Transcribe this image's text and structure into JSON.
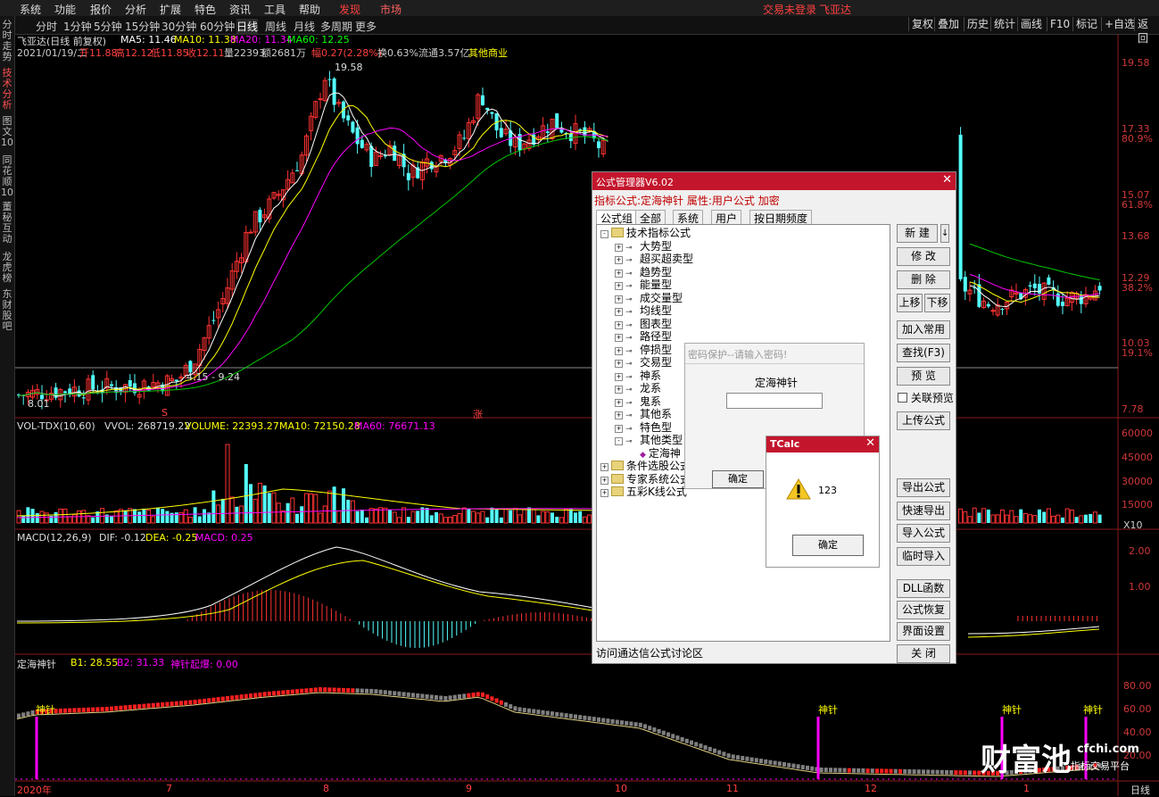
{
  "menu": {
    "items": [
      "系统",
      "功能",
      "报价",
      "分析",
      "扩展",
      "特色",
      "资讯",
      "工具",
      "帮助"
    ],
    "discover": "发现",
    "market": "市场",
    "login_status": "交易未登录",
    "stock_name": "飞亚达"
  },
  "toolbar": {
    "periods": [
      "分时",
      "1分钟",
      "5分钟",
      "15分钟",
      "30分钟",
      "60分钟",
      "日线",
      "周线",
      "月线",
      "多周期",
      "更多"
    ],
    "selected_period": "日线",
    "right_buttons": [
      "复权",
      "叠加",
      "历史",
      "统计",
      "画线",
      "F10",
      "标记",
      "+自选",
      "返回"
    ]
  },
  "left_tabs": [
    {
      "label": "分时走势",
      "active": false
    },
    {
      "label": "技术分析",
      "active": true
    },
    {
      "label": "图文10",
      "active": false
    },
    {
      "label": "同花顺10",
      "active": false
    },
    {
      "label": "董秘互动",
      "active": false
    },
    {
      "label": "龙虎榜",
      "active": false
    },
    {
      "label": "东财股吧",
      "active": false
    }
  ],
  "main_chart": {
    "title": "飞亚达(日线 前复权)",
    "ma": [
      {
        "label": "MA5: 11.46",
        "color": "#ffffff"
      },
      {
        "label": "MA10: 11.38",
        "color": "#ffff00"
      },
      {
        "label": "MA20: 11.34",
        "color": "#ff00ff"
      },
      {
        "label": "MA60: 12.25",
        "color": "#00ff00"
      }
    ],
    "quote_date": "2021/01/19/二",
    "quote_open": "开11.88",
    "quote_high": "高12.12",
    "quote_low": "低11.85",
    "quote_close": "收12.11",
    "quote_vol": "量22393",
    "quote_amt": "额2681万",
    "quote_chg": "幅0.27(2.28%)",
    "quote_turn": "换0.63%",
    "quote_float": "流通3.57亿",
    "quote_sector": "其他商业",
    "high_label": "19.58",
    "low_label": "8.01",
    "range_label": "4.15 - 9.24",
    "marker_s": "S",
    "marker_zhang": "涨",
    "axis": [
      "19.58",
      "17.33",
      "80.9%",
      "15.07",
      "61.8%",
      "13.68",
      "12.29",
      "38.2%",
      "10.03",
      "19.1%",
      "7.78"
    ]
  },
  "vol_chart": {
    "title": "VOL-TDX(10,60)",
    "vvol": "VVOL: 268719.22",
    "volume": "VOLUME: 22393.27",
    "ma10": "MA10: 72150.28",
    "ma60": "MA60: 76671.13",
    "axis": [
      "60000",
      "45000",
      "30000",
      "15000",
      "X10"
    ]
  },
  "macd_chart": {
    "title": "MACD(12,26,9)",
    "dif": "DIF: -0.12",
    "dea": "DEA: -0.25",
    "macd": "MACD: 0.25",
    "axis": [
      "2.00",
      "1.00"
    ]
  },
  "dh_chart": {
    "title": "定海神针",
    "b1": "B1: 28.55",
    "b2": "B2: 31.33",
    "qibao": "神针起爆: 0.00",
    "signal": "神针",
    "axis": [
      "80.00",
      "60.00",
      "40.00",
      "20.00"
    ]
  },
  "xaxis": [
    "2020年",
    "7",
    "8",
    "9",
    "10",
    "11",
    "12",
    "1"
  ],
  "xaxis_right": "日线",
  "watermark": {
    "big": "财富池",
    "small": "cfchi.com",
    "sub": "指标交易平台"
  },
  "formula_manager": {
    "title": "公式管理器V6.02",
    "subtitle": "指标公式:定海神针  属性:用户公式  加密",
    "tabs": [
      "公式组",
      "全部",
      "系统",
      "用户",
      "按日期频度"
    ],
    "tree": [
      {
        "label": "技术指标公式",
        "level": 0,
        "type": "folder",
        "sign": "-"
      },
      {
        "label": "大势型",
        "level": 1,
        "type": "key",
        "sign": "+"
      },
      {
        "label": "超买超卖型",
        "level": 1,
        "type": "key",
        "sign": "+"
      },
      {
        "label": "趋势型",
        "level": 1,
        "type": "key",
        "sign": "+"
      },
      {
        "label": "能量型",
        "level": 1,
        "type": "key",
        "sign": "+"
      },
      {
        "label": "成交量型",
        "level": 1,
        "type": "key",
        "sign": "+"
      },
      {
        "label": "均线型",
        "level": 1,
        "type": "key",
        "sign": "+"
      },
      {
        "label": "图表型",
        "level": 1,
        "type": "key",
        "sign": "+"
      },
      {
        "label": "路径型",
        "level": 1,
        "type": "key",
        "sign": "+"
      },
      {
        "label": "停损型",
        "level": 1,
        "type": "key",
        "sign": "+"
      },
      {
        "label": "交易型",
        "level": 1,
        "type": "key",
        "sign": "+"
      },
      {
        "label": "神系",
        "level": 1,
        "type": "key",
        "sign": "+"
      },
      {
        "label": "龙系",
        "level": 1,
        "type": "key",
        "sign": "+"
      },
      {
        "label": "鬼系",
        "level": 1,
        "type": "key",
        "sign": "+"
      },
      {
        "label": "其他系",
        "level": 1,
        "type": "key",
        "sign": "+"
      },
      {
        "label": "特色型",
        "level": 1,
        "type": "key",
        "sign": "+"
      },
      {
        "label": "其他类型",
        "level": 1,
        "type": "key",
        "sign": "-"
      },
      {
        "label": "定海神",
        "level": 2,
        "type": "formula",
        "sign": ""
      },
      {
        "label": "条件选股公式",
        "level": 0,
        "type": "folder",
        "sign": "+"
      },
      {
        "label": "专家系统公式",
        "level": 0,
        "type": "folder",
        "sign": "+"
      },
      {
        "label": "五彩K线公式",
        "level": 0,
        "type": "folder",
        "sign": "+"
      }
    ],
    "buttons": [
      "新  建",
      "修  改",
      "删  除",
      "上移",
      "下移",
      "加入常用",
      "查找(F3)",
      "预  览",
      "关联预览",
      "上传公式",
      "导出公式",
      "快速导出",
      "导入公式",
      "临时导入",
      "DLL函数",
      "公式恢复",
      "界面设置",
      "关  闭"
    ],
    "footer": "访问通达信公式讨论区"
  },
  "password_dialog": {
    "title": "密码保护--请输入密码!",
    "label": "定海神针",
    "value": "",
    "ok": "确定"
  },
  "tcalc": {
    "title": "TCalc",
    "message": "123",
    "ok": "确定"
  }
}
